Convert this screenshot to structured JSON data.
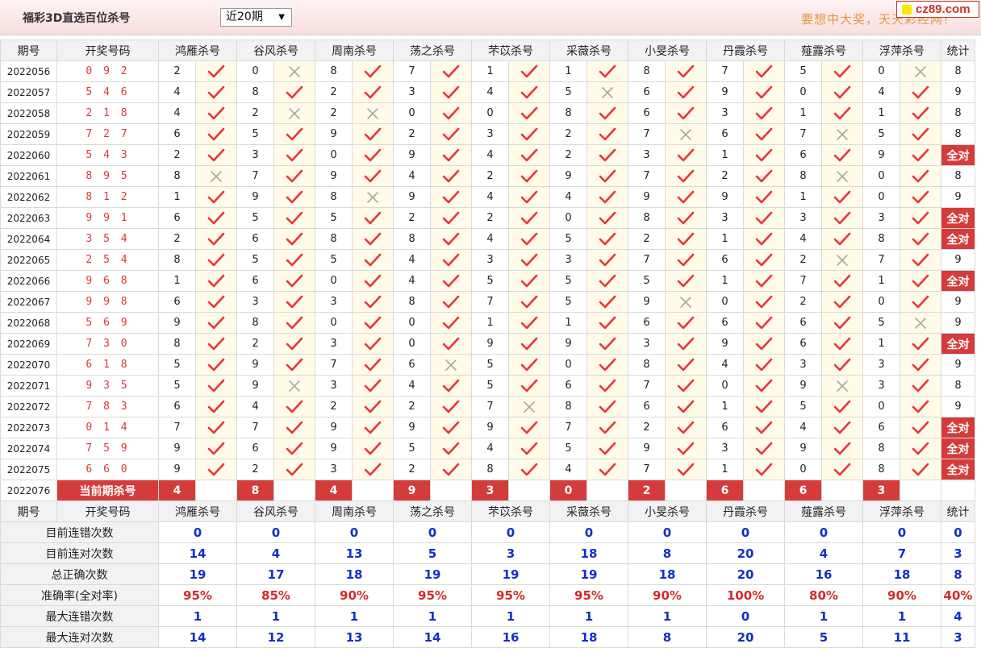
{
  "header": {
    "title": "福彩3D直选百位杀号",
    "period_select": "近20期",
    "slogan": "要想中大奖，天天彩经网！",
    "logo": "cz89.com"
  },
  "colors": {
    "accent": "#d43b3b",
    "number_red": "#d63a3a",
    "stat_blue": "#1030c8",
    "slogan_orange": "#e8963e"
  },
  "icons": {
    "correct": "check-icon",
    "wrong": "cross-icon"
  },
  "table": {
    "col_period": "期号",
    "col_draw": "开奖号码",
    "col_stat": "统计",
    "experts": [
      "鸿雁杀号",
      "谷风杀号",
      "周南杀号",
      "荡之杀号",
      "芣苡杀号",
      "采薇杀号",
      "小旻杀号",
      "丹霞杀号",
      "薤露杀号",
      "浮萍杀号"
    ],
    "rows": [
      {
        "period": "2022056",
        "draw": "0 9 2",
        "kills": [
          "2",
          "0",
          "8",
          "7",
          "1",
          "1",
          "8",
          "7",
          "5",
          "0"
        ],
        "ok": [
          1,
          0,
          1,
          1,
          1,
          1,
          1,
          1,
          1,
          0
        ],
        "stat": "8"
      },
      {
        "period": "2022057",
        "draw": "5 4 6",
        "kills": [
          "4",
          "8",
          "2",
          "3",
          "4",
          "5",
          "6",
          "9",
          "0",
          "4"
        ],
        "ok": [
          1,
          1,
          1,
          1,
          1,
          0,
          1,
          1,
          1,
          1
        ],
        "stat": "9"
      },
      {
        "period": "2022058",
        "draw": "2 1 8",
        "kills": [
          "4",
          "2",
          "2",
          "0",
          "0",
          "8",
          "6",
          "3",
          "1",
          "1"
        ],
        "ok": [
          1,
          0,
          0,
          1,
          1,
          1,
          1,
          1,
          1,
          1
        ],
        "stat": "8"
      },
      {
        "period": "2022059",
        "draw": "7 2 7",
        "kills": [
          "6",
          "5",
          "9",
          "2",
          "3",
          "2",
          "7",
          "6",
          "7",
          "5"
        ],
        "ok": [
          1,
          1,
          1,
          1,
          1,
          1,
          0,
          1,
          0,
          1
        ],
        "stat": "8"
      },
      {
        "period": "2022060",
        "draw": "5 4 3",
        "kills": [
          "2",
          "3",
          "0",
          "9",
          "4",
          "2",
          "3",
          "1",
          "6",
          "9"
        ],
        "ok": [
          1,
          1,
          1,
          1,
          1,
          1,
          1,
          1,
          1,
          1
        ],
        "stat": "全对"
      },
      {
        "period": "2022061",
        "draw": "8 9 5",
        "kills": [
          "8",
          "7",
          "9",
          "4",
          "2",
          "9",
          "7",
          "2",
          "8",
          "0"
        ],
        "ok": [
          0,
          1,
          1,
          1,
          1,
          1,
          1,
          1,
          0,
          1
        ],
        "stat": "8"
      },
      {
        "period": "2022062",
        "draw": "8 1 2",
        "kills": [
          "1",
          "9",
          "8",
          "9",
          "4",
          "4",
          "9",
          "9",
          "1",
          "0"
        ],
        "ok": [
          1,
          1,
          0,
          1,
          1,
          1,
          1,
          1,
          1,
          1
        ],
        "stat": "9"
      },
      {
        "period": "2022063",
        "draw": "9 9 1",
        "kills": [
          "6",
          "5",
          "5",
          "2",
          "2",
          "0",
          "8",
          "3",
          "3",
          "3"
        ],
        "ok": [
          1,
          1,
          1,
          1,
          1,
          1,
          1,
          1,
          1,
          1
        ],
        "stat": "全对"
      },
      {
        "period": "2022064",
        "draw": "3 5 4",
        "kills": [
          "2",
          "6",
          "8",
          "8",
          "4",
          "5",
          "2",
          "1",
          "4",
          "8"
        ],
        "ok": [
          1,
          1,
          1,
          1,
          1,
          1,
          1,
          1,
          1,
          1
        ],
        "stat": "全对"
      },
      {
        "period": "2022065",
        "draw": "2 5 4",
        "kills": [
          "8",
          "5",
          "5",
          "4",
          "3",
          "3",
          "7",
          "6",
          "2",
          "7"
        ],
        "ok": [
          1,
          1,
          1,
          1,
          1,
          1,
          1,
          1,
          0,
          1
        ],
        "stat": "9"
      },
      {
        "period": "2022066",
        "draw": "9 6 8",
        "kills": [
          "1",
          "6",
          "0",
          "4",
          "5",
          "5",
          "5",
          "1",
          "7",
          "1"
        ],
        "ok": [
          1,
          1,
          1,
          1,
          1,
          1,
          1,
          1,
          1,
          1
        ],
        "stat": "全对"
      },
      {
        "period": "2022067",
        "draw": "9 9 8",
        "kills": [
          "6",
          "3",
          "3",
          "8",
          "7",
          "5",
          "9",
          "0",
          "2",
          "0"
        ],
        "ok": [
          1,
          1,
          1,
          1,
          1,
          1,
          0,
          1,
          1,
          1
        ],
        "stat": "9"
      },
      {
        "period": "2022068",
        "draw": "5 6 9",
        "kills": [
          "9",
          "8",
          "0",
          "0",
          "1",
          "1",
          "6",
          "6",
          "6",
          "5"
        ],
        "ok": [
          1,
          1,
          1,
          1,
          1,
          1,
          1,
          1,
          1,
          0
        ],
        "stat": "9"
      },
      {
        "period": "2022069",
        "draw": "7 3 0",
        "kills": [
          "8",
          "2",
          "3",
          "0",
          "9",
          "9",
          "3",
          "9",
          "6",
          "1"
        ],
        "ok": [
          1,
          1,
          1,
          1,
          1,
          1,
          1,
          1,
          1,
          1
        ],
        "stat": "全对"
      },
      {
        "period": "2022070",
        "draw": "6 1 8",
        "kills": [
          "5",
          "9",
          "7",
          "6",
          "5",
          "0",
          "8",
          "4",
          "3",
          "3"
        ],
        "ok": [
          1,
          1,
          1,
          0,
          1,
          1,
          1,
          1,
          1,
          1
        ],
        "stat": "9"
      },
      {
        "period": "2022071",
        "draw": "9 3 5",
        "kills": [
          "5",
          "9",
          "3",
          "4",
          "5",
          "6",
          "7",
          "0",
          "9",
          "3"
        ],
        "ok": [
          1,
          0,
          1,
          1,
          1,
          1,
          1,
          1,
          0,
          1
        ],
        "stat": "8"
      },
      {
        "period": "2022072",
        "draw": "7 8 3",
        "kills": [
          "6",
          "4",
          "2",
          "2",
          "7",
          "8",
          "6",
          "1",
          "5",
          "0"
        ],
        "ok": [
          1,
          1,
          1,
          1,
          0,
          1,
          1,
          1,
          1,
          1
        ],
        "stat": "9"
      },
      {
        "period": "2022073",
        "draw": "0 1 4",
        "kills": [
          "7",
          "7",
          "9",
          "9",
          "9",
          "7",
          "2",
          "6",
          "4",
          "6"
        ],
        "ok": [
          1,
          1,
          1,
          1,
          1,
          1,
          1,
          1,
          1,
          1
        ],
        "stat": "全对"
      },
      {
        "period": "2022074",
        "draw": "7 5 9",
        "kills": [
          "9",
          "6",
          "9",
          "5",
          "4",
          "5",
          "9",
          "3",
          "9",
          "8"
        ],
        "ok": [
          1,
          1,
          1,
          1,
          1,
          1,
          1,
          1,
          1,
          1
        ],
        "stat": "全对"
      },
      {
        "period": "2022075",
        "draw": "6 6 0",
        "kills": [
          "9",
          "2",
          "3",
          "2",
          "8",
          "4",
          "7",
          "1",
          "0",
          "8"
        ],
        "ok": [
          1,
          1,
          1,
          1,
          1,
          1,
          1,
          1,
          1,
          1
        ],
        "stat": "全对"
      }
    ],
    "current": {
      "period": "2022076",
      "label": "当前期杀号",
      "kills": [
        "4",
        "8",
        "4",
        "9",
        "3",
        "0",
        "2",
        "6",
        "6",
        "3"
      ]
    },
    "summary": [
      {
        "label": "目前连错次数",
        "values": [
          "0",
          "0",
          "0",
          "0",
          "0",
          "0",
          "0",
          "0",
          "0",
          "0"
        ],
        "stat": "0",
        "pct": false
      },
      {
        "label": "目前连对次数",
        "values": [
          "14",
          "4",
          "13",
          "5",
          "3",
          "18",
          "8",
          "20",
          "4",
          "7"
        ],
        "stat": "3",
        "pct": false
      },
      {
        "label": "总正确次数",
        "values": [
          "19",
          "17",
          "18",
          "19",
          "19",
          "19",
          "18",
          "20",
          "16",
          "18"
        ],
        "stat": "8",
        "pct": false
      },
      {
        "label": "准确率(全对率)",
        "values": [
          "95%",
          "85%",
          "90%",
          "95%",
          "95%",
          "95%",
          "90%",
          "100%",
          "80%",
          "90%"
        ],
        "stat": "40%",
        "pct": true
      },
      {
        "label": "最大连错次数",
        "values": [
          "1",
          "1",
          "1",
          "1",
          "1",
          "1",
          "1",
          "0",
          "1",
          "1"
        ],
        "stat": "4",
        "pct": false
      },
      {
        "label": "最大连对次数",
        "values": [
          "14",
          "12",
          "13",
          "14",
          "16",
          "18",
          "8",
          "20",
          "5",
          "11"
        ],
        "stat": "3",
        "pct": false
      }
    ]
  }
}
